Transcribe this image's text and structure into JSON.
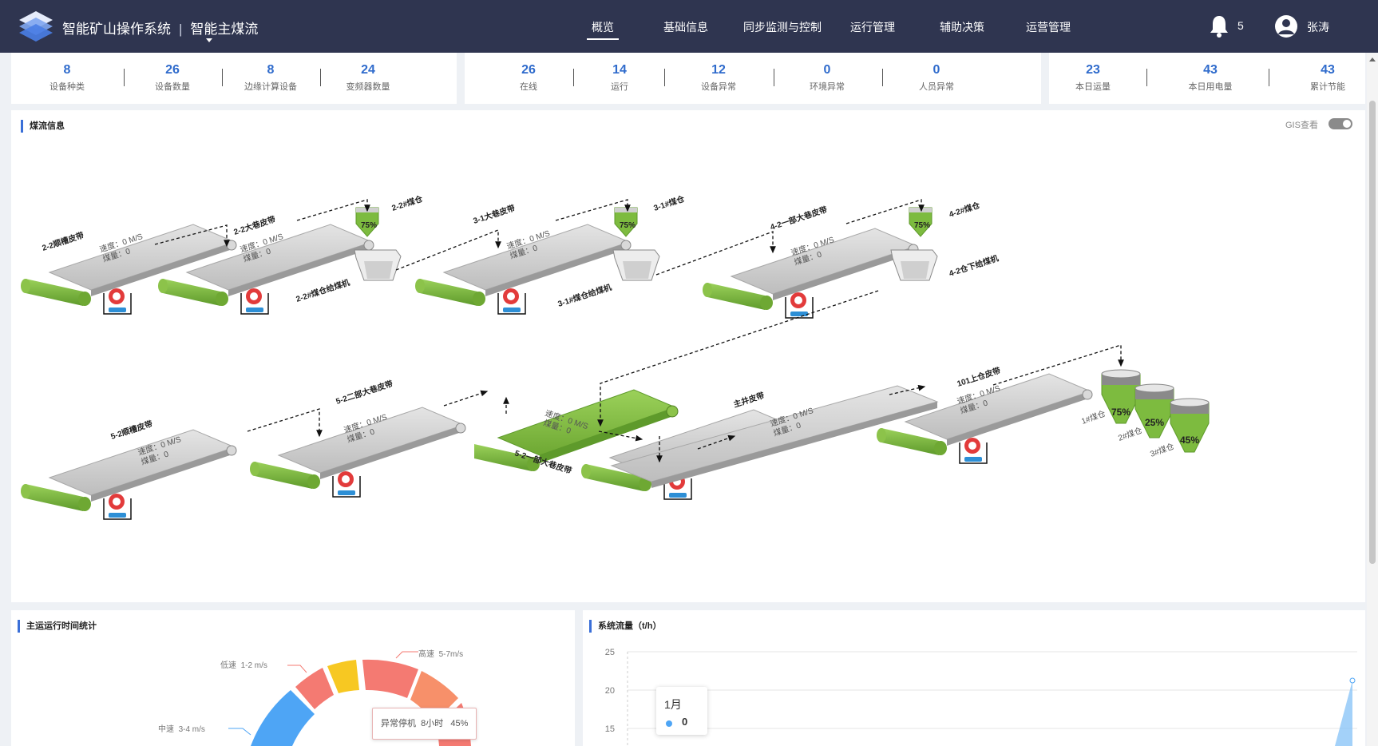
{
  "header": {
    "system_name": "智能矿山操作系统",
    "separator": "|",
    "module_name": "智能主煤流",
    "nav": [
      {
        "label": "概览",
        "active": true
      },
      {
        "label": "基础信息"
      },
      {
        "label": "同步监测与控制"
      },
      {
        "label": "运行管理"
      },
      {
        "label": "辅助决策"
      },
      {
        "label": "运营管理"
      }
    ],
    "notification_count": "5",
    "user_name": "张涛",
    "icons": [
      "logo-layers-icon",
      "bell-icon",
      "user-avatar-icon"
    ]
  },
  "stats": [
    [
      {
        "value": "8",
        "label": "设备种类"
      },
      {
        "value": "26",
        "label": "设备数量"
      },
      {
        "value": "8",
        "label": "边缘计算设备"
      },
      {
        "value": "24",
        "label": "变频器数量"
      }
    ],
    [
      {
        "value": "26",
        "label": "在线"
      },
      {
        "value": "14",
        "label": "运行"
      },
      {
        "value": "12",
        "label": "设备异常"
      },
      {
        "value": "0",
        "label": "环境异常"
      },
      {
        "value": "0",
        "label": "人员异常"
      }
    ],
    [
      {
        "value": "23",
        "label": "本日运量"
      },
      {
        "value": "43",
        "label": "本日用电量"
      },
      {
        "value": "43",
        "label": "累计节能"
      }
    ]
  ],
  "coal_flow": {
    "title": "煤流信息",
    "gis_label": "GIS查看",
    "speed_text": "速度：0 M/S",
    "amount_text": "煤量：0",
    "belts": [
      {
        "name": "2-2顺槽皮带"
      },
      {
        "name": "2-2大巷皮带"
      },
      {
        "name": "3-1大巷皮带"
      },
      {
        "name": "4-2一部大巷皮带"
      },
      {
        "name": "5-2顺槽皮带"
      },
      {
        "name": "5-2二部大巷皮带"
      },
      {
        "name": "5-2一部大巷皮带"
      },
      {
        "name": "主井皮带"
      },
      {
        "name": "101上仓皮带"
      }
    ],
    "bunkers": [
      {
        "name": "2-2#煤仓",
        "level": "75%"
      },
      {
        "name": "3-1#煤仓",
        "level": "75%"
      },
      {
        "name": "4-2#煤仓",
        "level": "75%"
      }
    ],
    "feeders": [
      {
        "name": "2-2#煤仓给煤机"
      },
      {
        "name": "3-1#煤仓给煤机"
      },
      {
        "name": "4-2仓下给煤机"
      }
    ],
    "silos": [
      {
        "name": "1#煤仓",
        "level": "75%"
      },
      {
        "name": "2#煤仓",
        "level": "25%"
      },
      {
        "name": "3#煤仓",
        "level": "45%"
      }
    ]
  },
  "runtime_stats": {
    "title": "主运运行时间统计",
    "legend": [
      {
        "label": "低速",
        "range": "1-2 m/s"
      },
      {
        "label": "中速",
        "range": "3-4 m/s"
      },
      {
        "label": "高速",
        "range": "5-7m/s"
      }
    ],
    "tooltip": {
      "label": "异常停机",
      "hours": "8小时",
      "percent": "45%"
    }
  },
  "system_flow": {
    "title": "系统流量（t/h）",
    "tooltip": {
      "month": "1月",
      "value": "0"
    }
  },
  "chart_data": {
    "type": "area",
    "title": "系统流量（t/h）",
    "y_ticks": [
      "25",
      "20",
      "15"
    ],
    "ylim": [
      15,
      25
    ],
    "series": [
      {
        "values": [
          0
        ]
      }
    ],
    "categories": [
      "1月"
    ],
    "grid": true
  },
  "colors": {
    "header_bg": "#2f3550",
    "accent": "#3a6fd8",
    "stat_value": "#2f6bcc",
    "belt_green": "#7dbb3f",
    "belt_gray": "#cfcfcf"
  }
}
